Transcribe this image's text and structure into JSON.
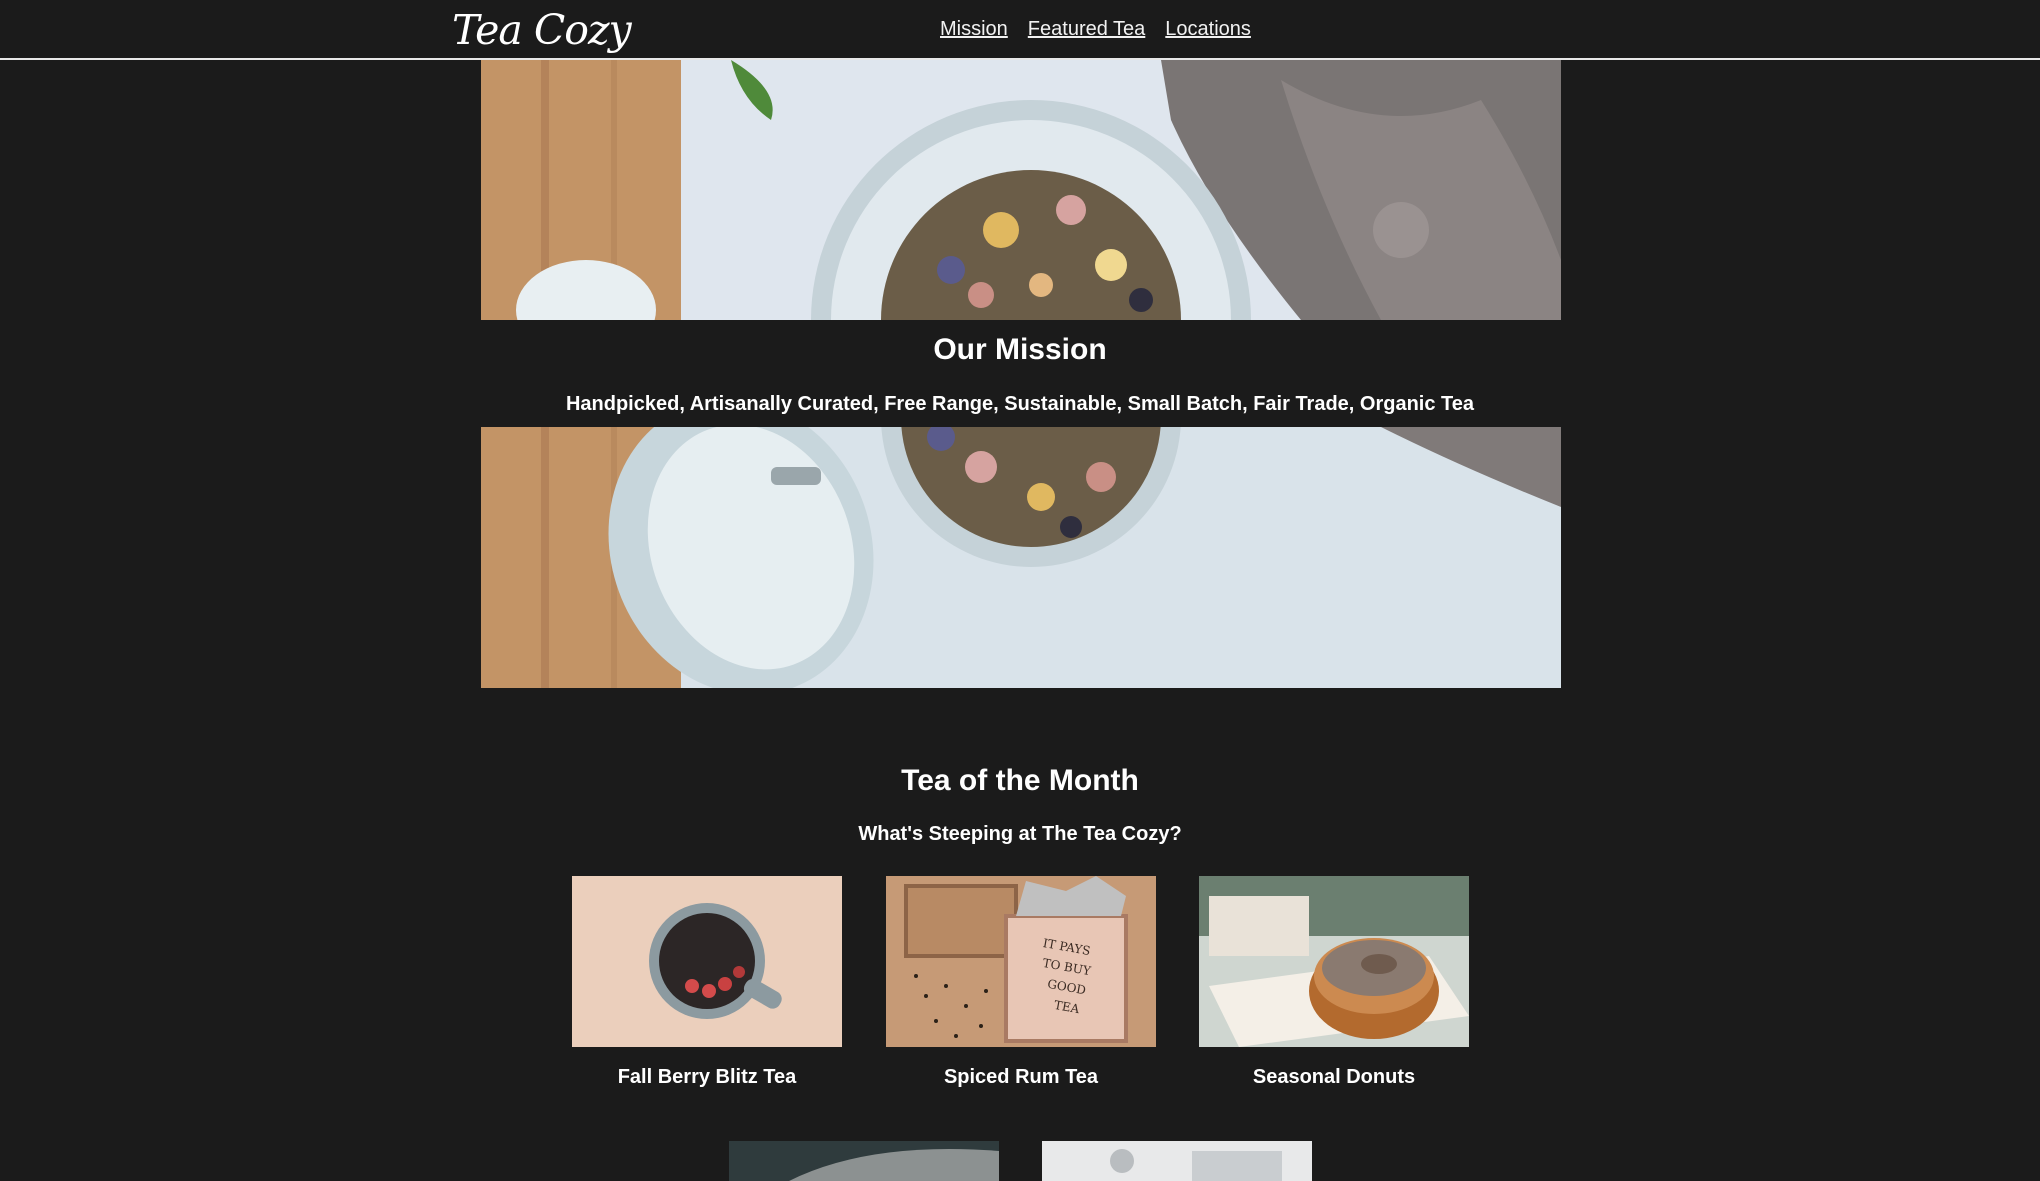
{
  "header": {
    "logo": "Tea Cozy",
    "nav": [
      "Mission",
      "Featured Tea",
      "Locations"
    ]
  },
  "hero": {
    "top_image": "tea-jar-top-photo",
    "bottom_image": "tea-jar-bottom-photo"
  },
  "mission": {
    "title": "Our Mission",
    "subtitle": "Handpicked, Artisanally Curated, Free Range, Sustainable, Small Batch, Fair Trade, Organic Tea"
  },
  "tea_of_month": {
    "title": "Tea of the Month",
    "subtitle": "What's Steeping at The Tea Cozy?",
    "items": [
      {
        "name": "Fall Berry Blitz Tea",
        "image": "berry-tea-cup-photo"
      },
      {
        "name": "Spiced Rum Tea",
        "image": "tea-crate-photo"
      },
      {
        "name": "Seasonal Donuts",
        "image": "donut-photo"
      },
      {
        "image": "partial-photo-4"
      },
      {
        "image": "partial-photo-5"
      }
    ]
  },
  "colors": {
    "background": "#1b1b1b",
    "text": "#ffffff",
    "header_border": "#e8e8e8"
  }
}
